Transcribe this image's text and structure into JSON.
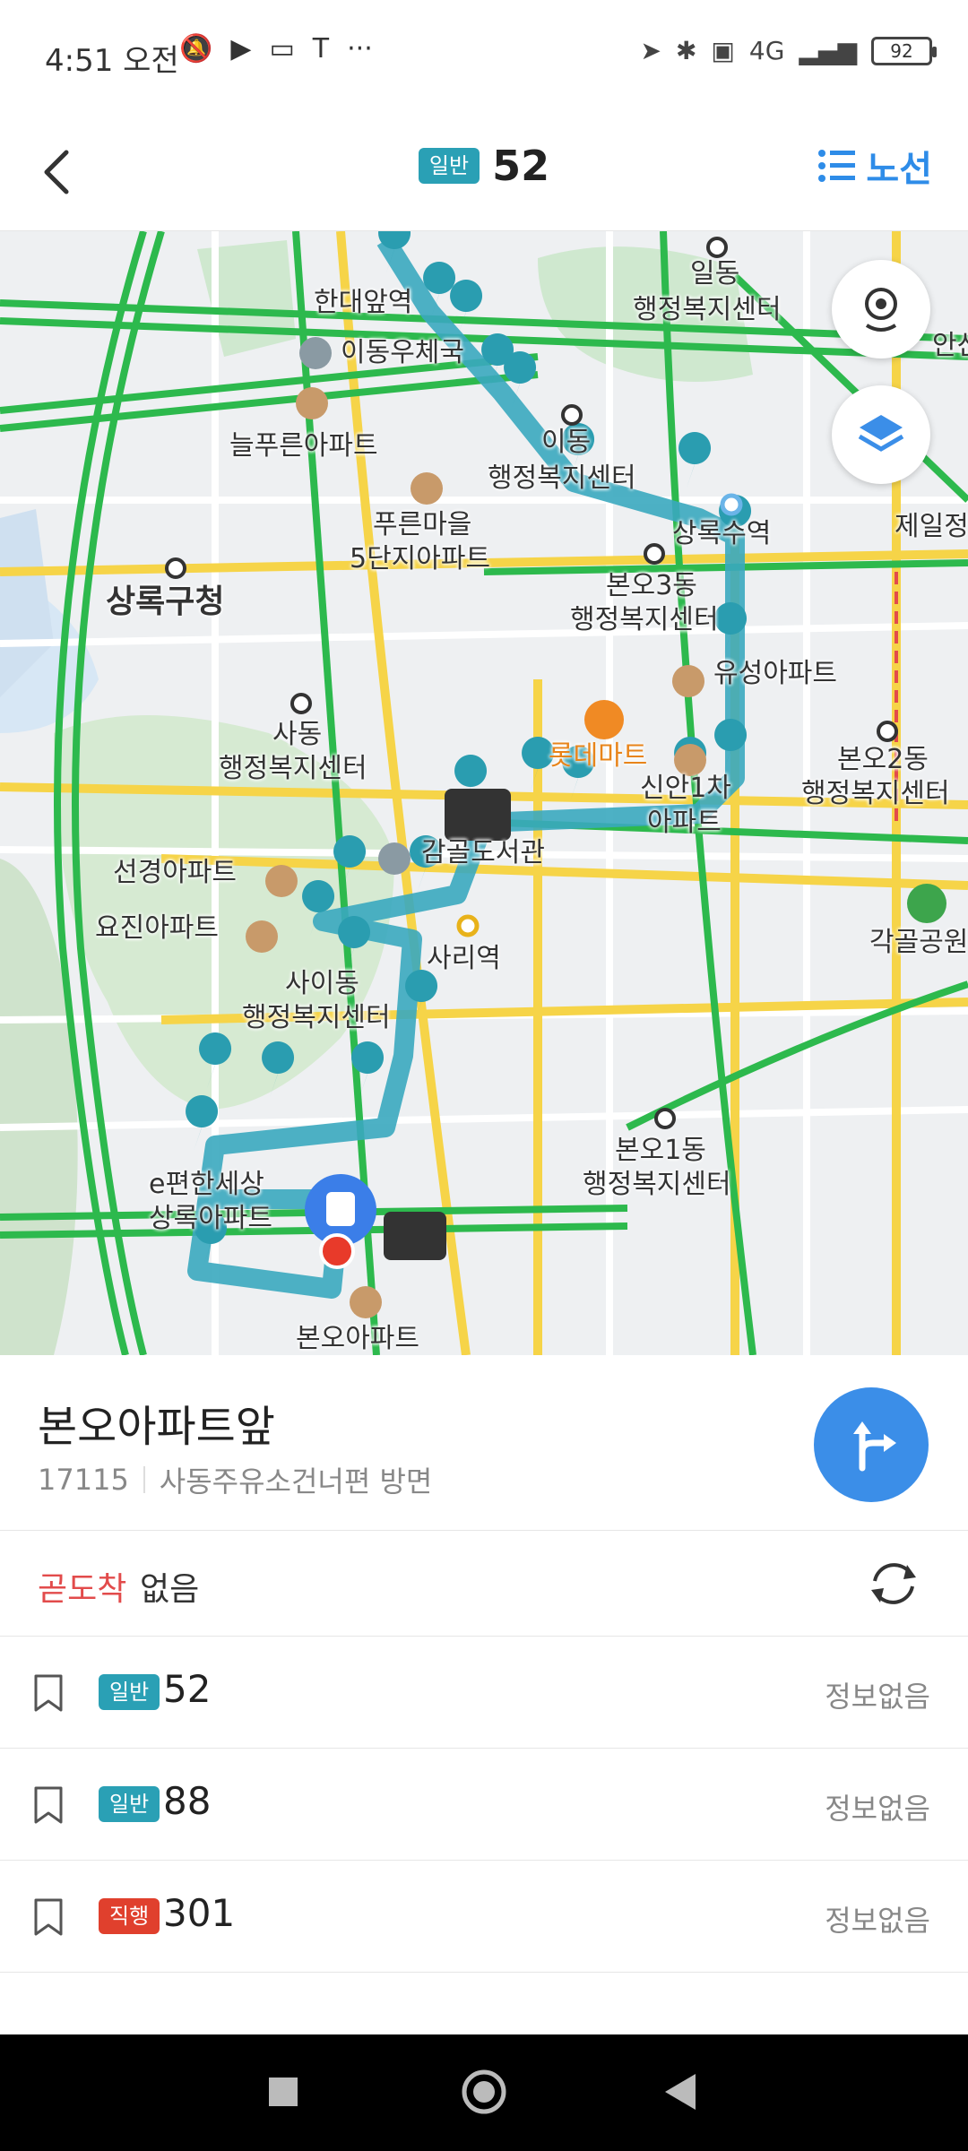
{
  "status": {
    "time": "4:51 오전",
    "battery": "92",
    "network": "4G"
  },
  "header": {
    "badge": "일반",
    "route_number": "52",
    "route_button": "노선"
  },
  "map": {
    "labels": {
      "handae": "한대앞역",
      "idong_post": "이동우체국",
      "ildong": "일동",
      "ildong_center": "행정복지센터",
      "ansan": "안산",
      "neulpureun": "늘푸른아파트",
      "idong_center1": "이동",
      "idong_center2": "행정복지센터",
      "pureunmaeul1": "푸른마을",
      "pureunmaeul2": "5단지아파트",
      "sangnok_station": "상록수역",
      "jeil": "제일정",
      "sangnok_gu": "상록구청",
      "bono3_1": "본오3동",
      "bono3_2": "행정복지센터",
      "yuseong": "유성아파트",
      "sadong1": "사동",
      "sadong2": "행정복지센터",
      "lotte": "롯데마트",
      "bono2_1": "본오2동",
      "bono2_2": "행정복지센터",
      "sinan1": "신안1차",
      "sinan2": "아파트",
      "seongyeong": "선경아파트",
      "library": "감골도서관",
      "yojin": "요진아파트",
      "sari": "사리역",
      "gakgol": "각골공원",
      "sai1": "사이동",
      "sai2": "행정복지센터",
      "bono1_1": "본오1동",
      "bono1_2": "행정복지센터",
      "epyeonhan1": "e편한세상",
      "epyeonhan2": "상록아파트",
      "bono_apt": "본오아파트"
    }
  },
  "stop": {
    "name": "본오아파트앞",
    "id": "17115",
    "direction": "사동주유소건너편 방면"
  },
  "arrival": {
    "label": "곧도착",
    "value": "없음"
  },
  "buses": [
    {
      "type": "일반",
      "type_color": "#2aa0b5",
      "number": "52",
      "info": "정보없음"
    },
    {
      "type": "일반",
      "type_color": "#2aa0b5",
      "number": "88",
      "info": "정보없음"
    },
    {
      "type": "직행",
      "type_color": "#e0402d",
      "number": "301",
      "info": "정보없음"
    }
  ]
}
